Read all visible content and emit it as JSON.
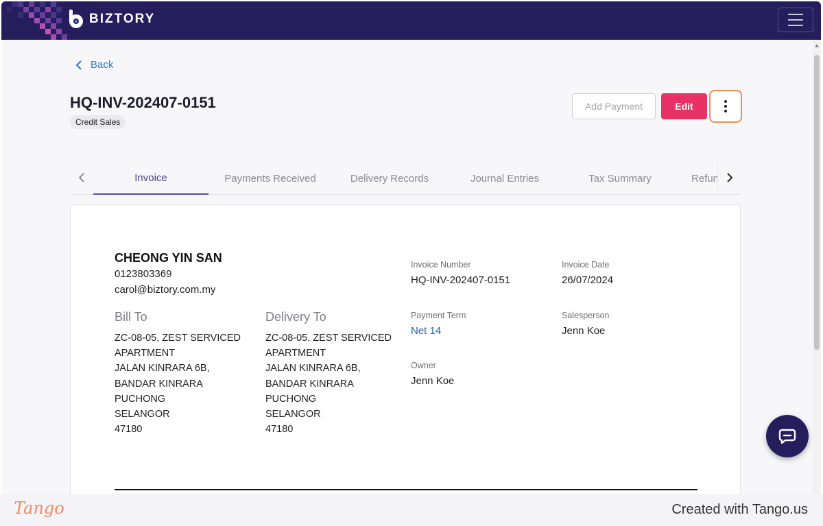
{
  "app": {
    "brand": "BIZTORY",
    "colors": {
      "navbar": "#261e5c",
      "accent": "#e83266",
      "tab_active": "#5b46a8",
      "link": "#2b7bc9",
      "highlight": "#f28b4c"
    }
  },
  "navbar": {
    "menu_icon": "hamburger-icon"
  },
  "page": {
    "back_label": "Back",
    "title": "HQ-INV-202407-0151",
    "tag": "Credit Sales",
    "actions": {
      "add_payment": "Add Payment",
      "edit": "Edit",
      "more_icon": "more-vertical-icon"
    }
  },
  "tabs": [
    {
      "label": "Invoice",
      "active": true
    },
    {
      "label": "Payments Received",
      "active": false
    },
    {
      "label": "Delivery Records",
      "active": false
    },
    {
      "label": "Journal Entries",
      "active": false
    },
    {
      "label": "Tax Summary",
      "active": false
    },
    {
      "label": "Refunds",
      "active": false
    }
  ],
  "invoice": {
    "customer": {
      "name": "CHEONG YIN SAN",
      "phone": "0123803369",
      "email": "carol@biztory.com.my"
    },
    "bill_to": {
      "heading": "Bill To",
      "lines": [
        "ZC-08-05, ZEST SERVICED",
        "APARTMENT",
        "JALAN KINRARA 6B,",
        "BANDAR KINRARA",
        "PUCHONG",
        "SELANGOR",
        "47180"
      ]
    },
    "delivery_to": {
      "heading": "Delivery To",
      "lines": [
        "ZC-08-05, ZEST SERVICED",
        "APARTMENT",
        "JALAN KINRARA 6B,",
        "BANDAR KINRARA",
        "PUCHONG",
        "SELANGOR",
        "47180"
      ]
    },
    "fields": {
      "invoice_number": {
        "label": "Invoice Number",
        "value": "HQ-INV-202407-0151"
      },
      "invoice_date": {
        "label": "Invoice Date",
        "value": "26/07/2024"
      },
      "payment_term": {
        "label": "Payment Term",
        "value": "Net 14"
      },
      "salesperson": {
        "label": "Salesperson",
        "value": "Jenn Koe"
      },
      "owner": {
        "label": "Owner",
        "value": "Jenn Koe"
      }
    }
  },
  "chat": {
    "icon": "chat-icon"
  },
  "footer": {
    "logo": "Tango",
    "credit": "Created with Tango.us"
  }
}
